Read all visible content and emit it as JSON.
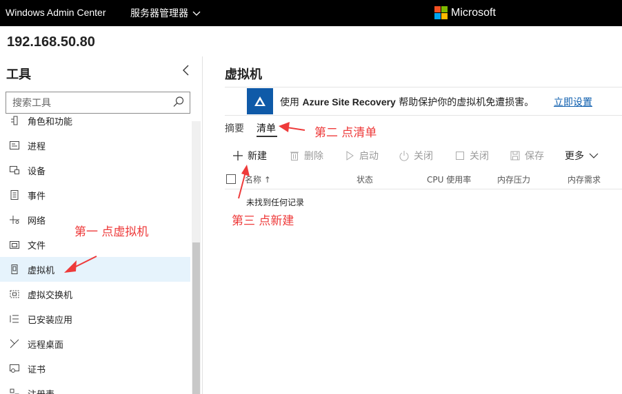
{
  "header": {
    "app_title": "Windows Admin Center",
    "server_menu": "服务器管理器",
    "brand": "Microsoft"
  },
  "host": "192.168.50.80",
  "tools": {
    "title": "工具",
    "search_placeholder": "搜索工具",
    "items": [
      {
        "label": "角色和功能",
        "icon": "roles-icon"
      },
      {
        "label": "进程",
        "icon": "process-icon"
      },
      {
        "label": "设备",
        "icon": "device-icon"
      },
      {
        "label": "事件",
        "icon": "events-icon"
      },
      {
        "label": "网络",
        "icon": "network-icon"
      },
      {
        "label": "文件",
        "icon": "files-icon"
      },
      {
        "label": "虚拟机",
        "icon": "virtual-machine-icon",
        "active": true
      },
      {
        "label": "虚拟交换机",
        "icon": "virtual-switch-icon"
      },
      {
        "label": "已安装应用",
        "icon": "installed-apps-icon"
      },
      {
        "label": "远程桌面",
        "icon": "remote-desktop-icon"
      },
      {
        "label": "证书",
        "icon": "certificate-icon"
      },
      {
        "label": "注册表",
        "icon": "registry-icon"
      }
    ]
  },
  "main": {
    "title": "虚拟机",
    "banner": {
      "prefix": "使用 ",
      "product": "Azure Site Recovery",
      "suffix": " 帮助保护你的虚拟机免遭损害。",
      "link": "立即设置"
    },
    "tabs": {
      "summary": "摘要",
      "list": "清单"
    },
    "toolbar": {
      "new": "新建",
      "delete": "删除",
      "start": "启动",
      "shutdown": "关闭",
      "stop": "关闭",
      "save": "保存",
      "more": "更多"
    },
    "table": {
      "columns": [
        "名称 ↑",
        "状态",
        "CPU 使用率",
        "内存压力",
        "内存需求"
      ],
      "empty": "未找到任何记录"
    }
  },
  "annotations": {
    "step1": "第一  点虚拟机",
    "step2": "第二  点清单",
    "step3": "第三  点新建"
  },
  "colors": {
    "topbar": "#000000",
    "accent": "#0f5aa8",
    "link": "#0b5cad",
    "active_item": "#e6f3fc",
    "annotation": "#ee3a3a"
  }
}
